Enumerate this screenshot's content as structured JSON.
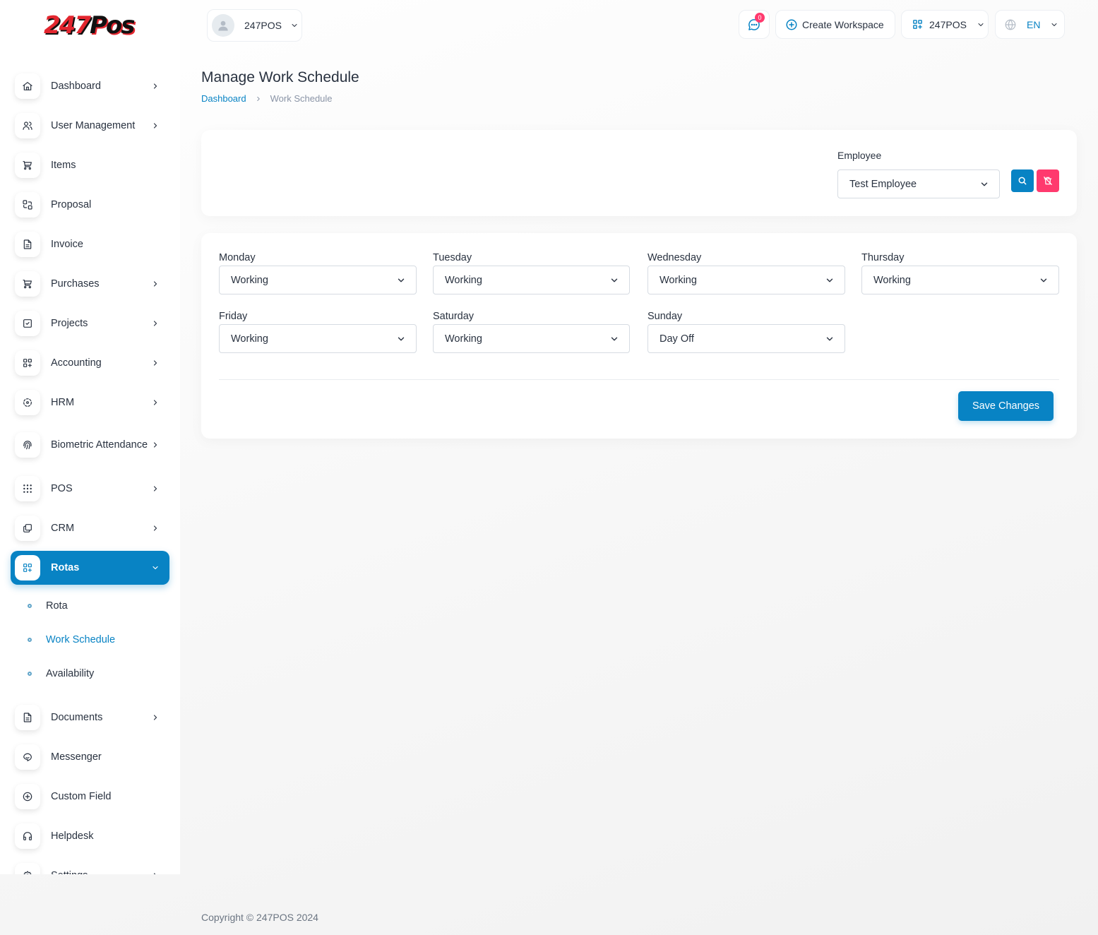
{
  "brand": {
    "logo_part1": "24",
    "logo_part2": "7",
    "logo_part3": "Pos"
  },
  "sidebar": {
    "items": [
      {
        "label": "Dashboard",
        "icon": "home-icon",
        "chevron": true
      },
      {
        "label": "User Management",
        "icon": "users-icon",
        "chevron": true
      },
      {
        "label": "Items",
        "icon": "cart-icon",
        "chevron": false
      },
      {
        "label": "Proposal",
        "icon": "swap-icon",
        "chevron": false
      },
      {
        "label": "Invoice",
        "icon": "file-icon",
        "chevron": false
      },
      {
        "label": "Purchases",
        "icon": "cart-icon",
        "chevron": true
      },
      {
        "label": "Projects",
        "icon": "checkbox-icon",
        "chevron": true
      },
      {
        "label": "Accounting",
        "icon": "apps-icon",
        "chevron": true
      },
      {
        "label": "HRM",
        "icon": "dashed-circle-icon",
        "chevron": true
      },
      {
        "label": "Biometric Attendance",
        "icon": "fingerprint-icon",
        "chevron": true
      },
      {
        "label": "POS",
        "icon": "grid-dots-icon",
        "chevron": true
      },
      {
        "label": "CRM",
        "icon": "layers-icon",
        "chevron": true
      },
      {
        "label": "Rotas",
        "icon": "apps-icon",
        "chevron": true,
        "active": true
      },
      {
        "label": "Documents",
        "icon": "file-icon",
        "chevron": true
      },
      {
        "label": "Messenger",
        "icon": "message-icon",
        "chevron": false
      },
      {
        "label": "Custom Field",
        "icon": "plus-circle-icon",
        "chevron": false
      },
      {
        "label": "Helpdesk",
        "icon": "headset-icon",
        "chevron": false
      },
      {
        "label": "Settings",
        "icon": "gear-icon",
        "chevron": true
      }
    ],
    "rotas_sub": [
      {
        "label": "Rota"
      },
      {
        "label": "Work Schedule",
        "active": true
      },
      {
        "label": "Availability"
      }
    ]
  },
  "header": {
    "workspace_name": "247POS",
    "notification_count": "0",
    "create_workspace_label": "Create Workspace",
    "company_label": "247POS",
    "language_label": "EN"
  },
  "page": {
    "title": "Manage Work Schedule",
    "breadcrumb": [
      "Dashboard",
      "Work Schedule"
    ]
  },
  "filter": {
    "employee_label": "Employee",
    "employee_value": "Test Employee"
  },
  "schedule": {
    "days": [
      {
        "day": "Monday",
        "value": "Working"
      },
      {
        "day": "Tuesday",
        "value": "Working"
      },
      {
        "day": "Wednesday",
        "value": "Working"
      },
      {
        "day": "Thursday",
        "value": "Working"
      },
      {
        "day": "Friday",
        "value": "Working"
      },
      {
        "day": "Saturday",
        "value": "Working"
      },
      {
        "day": "Sunday",
        "value": "Day Off"
      }
    ],
    "save_label": "Save Changes"
  },
  "footer": {
    "copyright": "Copyright © 247POS 2024"
  },
  "colors": {
    "primary": "#0883c4",
    "danger": "#ff3a6e",
    "text": "#293240"
  }
}
